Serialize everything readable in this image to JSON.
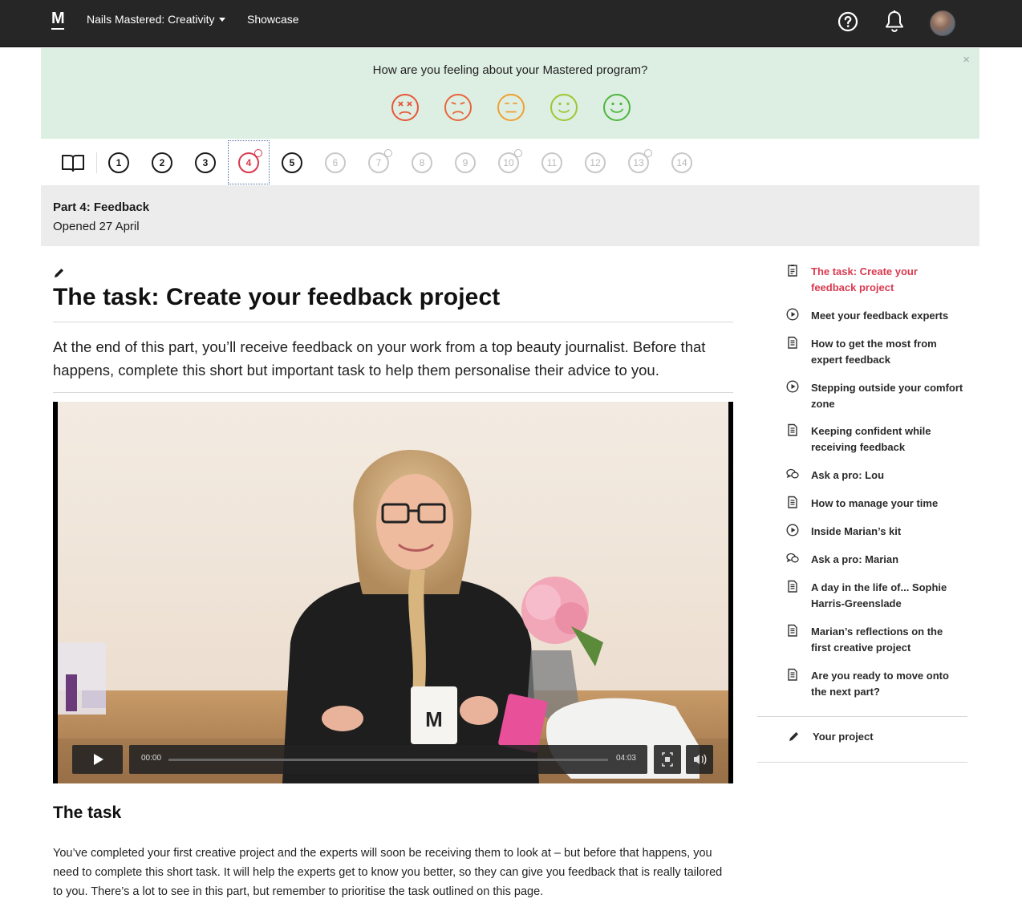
{
  "topbar": {
    "logo_text": "M",
    "course_label": "Nails Mastered: Creativity",
    "showcase_label": "Showcase"
  },
  "banner": {
    "question": "How are you feeling about your Mastered program?",
    "close": "×",
    "faces": [
      {
        "name": "very-unhappy",
        "color": "#e8563a"
      },
      {
        "name": "unhappy",
        "color": "#e8663a"
      },
      {
        "name": "neutral",
        "color": "#f0a032"
      },
      {
        "name": "happy",
        "color": "#9bc832"
      },
      {
        "name": "very-happy",
        "color": "#4cb63c"
      }
    ]
  },
  "parts": {
    "items": [
      {
        "label": "1",
        "state": "done"
      },
      {
        "label": "2",
        "state": "done"
      },
      {
        "label": "3",
        "state": "done"
      },
      {
        "label": "4",
        "state": "active",
        "badge": true
      },
      {
        "label": "5",
        "state": "done"
      },
      {
        "label": "6",
        "state": "locked"
      },
      {
        "label": "7",
        "state": "locked",
        "badge": true
      },
      {
        "label": "8",
        "state": "locked"
      },
      {
        "label": "9",
        "state": "locked"
      },
      {
        "label": "10",
        "state": "locked",
        "badge": true
      },
      {
        "label": "11",
        "state": "locked"
      },
      {
        "label": "12",
        "state": "locked"
      },
      {
        "label": "13",
        "state": "locked",
        "badge": true
      },
      {
        "label": "14",
        "state": "locked"
      }
    ]
  },
  "part_header": {
    "title": "Part 4: Feedback",
    "opened": "Opened 27 April"
  },
  "main": {
    "title": "The task: Create your feedback project",
    "intro": "At the end of this part, you’ll receive feedback on your work from a top beauty journalist. Before that happens, complete this short but important task to help them personalise their advice to you.",
    "video": {
      "current_time": "00:00",
      "duration": "04:03",
      "progress": 0
    },
    "task_heading": "The task",
    "task_body": "You’ve completed your first creative project and the experts will soon be receiving them to look at – but before that happens, you need to complete this short task. It will help the experts get to know you better, so they can give you feedback that is really tailored to you. There’s a lot to see in this part, but remember to prioritise the task outlined on this page."
  },
  "sidebar": {
    "items": [
      {
        "label": "The task: Create your feedback project",
        "icon": "task-icon",
        "current": true
      },
      {
        "label": "Meet your feedback experts",
        "icon": "play-icon"
      },
      {
        "label": "How to get the most from expert feedback",
        "icon": "document-icon"
      },
      {
        "label": "Stepping outside your comfort zone",
        "icon": "play-icon"
      },
      {
        "label": "Keeping confident while receiving feedback",
        "icon": "document-icon"
      },
      {
        "label": "Ask a pro: Lou",
        "icon": "chat-icon"
      },
      {
        "label": "How to manage your time",
        "icon": "document-icon"
      },
      {
        "label": "Inside Marian’s kit",
        "icon": "play-icon"
      },
      {
        "label": "Ask a pro: Marian",
        "icon": "chat-icon"
      },
      {
        "label": "A day in the life of... Sophie Harris-Greenslade",
        "icon": "document-icon"
      },
      {
        "label": "Marian’s reflections on the first creative project",
        "icon": "document-icon"
      },
      {
        "label": "Are you ready to move onto the next part?",
        "icon": "document-icon"
      }
    ],
    "project_label": "Your project"
  },
  "colors": {
    "accent": "#d9394f",
    "topbar": "#262626",
    "banner": "#ddeee2",
    "part_header": "#ececec"
  }
}
